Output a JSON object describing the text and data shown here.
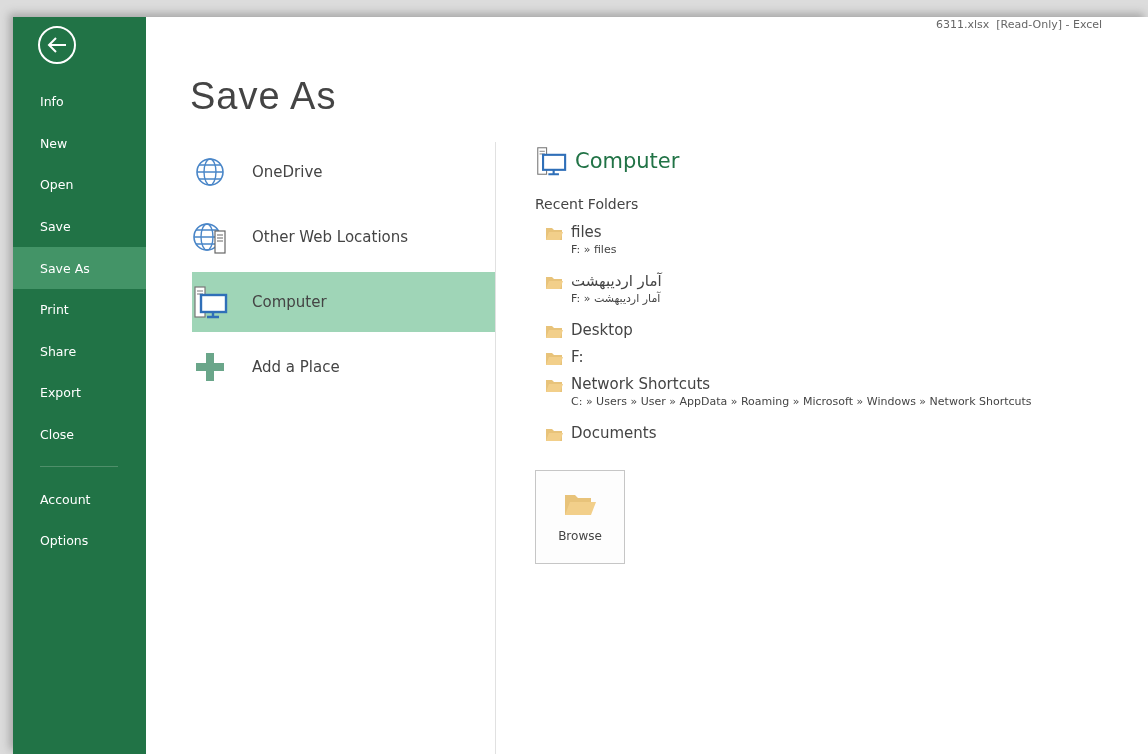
{
  "window": {
    "title": "6311.xlsx  [Read-Only] - Excel"
  },
  "sidebar": {
    "items": [
      {
        "label": "Info",
        "selected": false
      },
      {
        "label": "New",
        "selected": false
      },
      {
        "label": "Open",
        "selected": false
      },
      {
        "label": "Save",
        "selected": false
      },
      {
        "label": "Save As",
        "selected": true
      },
      {
        "label": "Print",
        "selected": false
      },
      {
        "label": "Share",
        "selected": false
      },
      {
        "label": "Export",
        "selected": false
      },
      {
        "label": "Close",
        "selected": false
      }
    ],
    "footer_items": [
      {
        "label": "Account",
        "selected": false
      },
      {
        "label": "Options",
        "selected": false
      }
    ]
  },
  "page_title": "Save As",
  "places": [
    {
      "label": "OneDrive",
      "kind": "globe",
      "selected": false
    },
    {
      "label": "Other Web Locations",
      "kind": "web",
      "selected": false
    },
    {
      "label": "Computer",
      "kind": "computer",
      "selected": true
    },
    {
      "label": "Add a Place",
      "kind": "add",
      "selected": false
    }
  ],
  "detail": {
    "heading": "Computer",
    "section": "Recent Folders",
    "folders": [
      {
        "name": "files",
        "path": "F: » files"
      },
      {
        "name": "آمار اردیبهشت",
        "path": "F: » آمار اردیبهشت"
      },
      {
        "name": "Desktop"
      },
      {
        "name": "F:"
      },
      {
        "name": "Network Shortcuts",
        "path": "C: » Users » User » AppData » Roaming » Microsoft » Windows » Network Shortcuts"
      },
      {
        "name": "Documents"
      }
    ],
    "browse_button": "Browse"
  }
}
